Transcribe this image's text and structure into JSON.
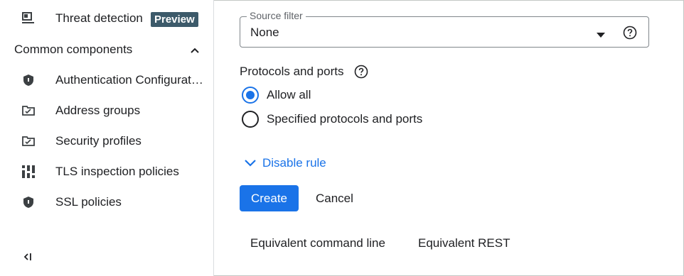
{
  "sidebar": {
    "items_top": [
      {
        "label": "Threat detection",
        "icon": "threat-detection-icon",
        "badge": "Preview"
      }
    ],
    "section": {
      "label": "Common components",
      "expanded": true,
      "icon": "chevron-up-icon"
    },
    "items": [
      {
        "label": "Authentication Configurat…",
        "icon": "shield-icon"
      },
      {
        "label": "Address groups",
        "icon": "folder-check-icon"
      },
      {
        "label": "Security profiles",
        "icon": "folder-check-icon"
      },
      {
        "label": "TLS inspection policies",
        "icon": "tls-policy-icon"
      },
      {
        "label": "SSL policies",
        "icon": "shield-icon"
      }
    ],
    "collapse_icon": "collapse-sidebar-icon"
  },
  "main": {
    "source_filter": {
      "label": "Source filter",
      "value": "None",
      "icon": "dropdown-arrow-icon"
    },
    "protocols": {
      "title": "Protocols and ports",
      "options": [
        {
          "label": "Allow all",
          "selected": true
        },
        {
          "label": "Specified protocols and ports",
          "selected": false
        }
      ]
    },
    "disable_rule": {
      "label": "Disable rule",
      "icon": "chevron-down-icon"
    },
    "actions": {
      "create": "Create",
      "cancel": "Cancel"
    },
    "equivalents": {
      "command_line": "Equivalent command line",
      "rest": "Equivalent REST"
    }
  },
  "colors": {
    "accent": "#1a73e8",
    "badge_bg": "#3c5a6a",
    "text": "#202124"
  }
}
